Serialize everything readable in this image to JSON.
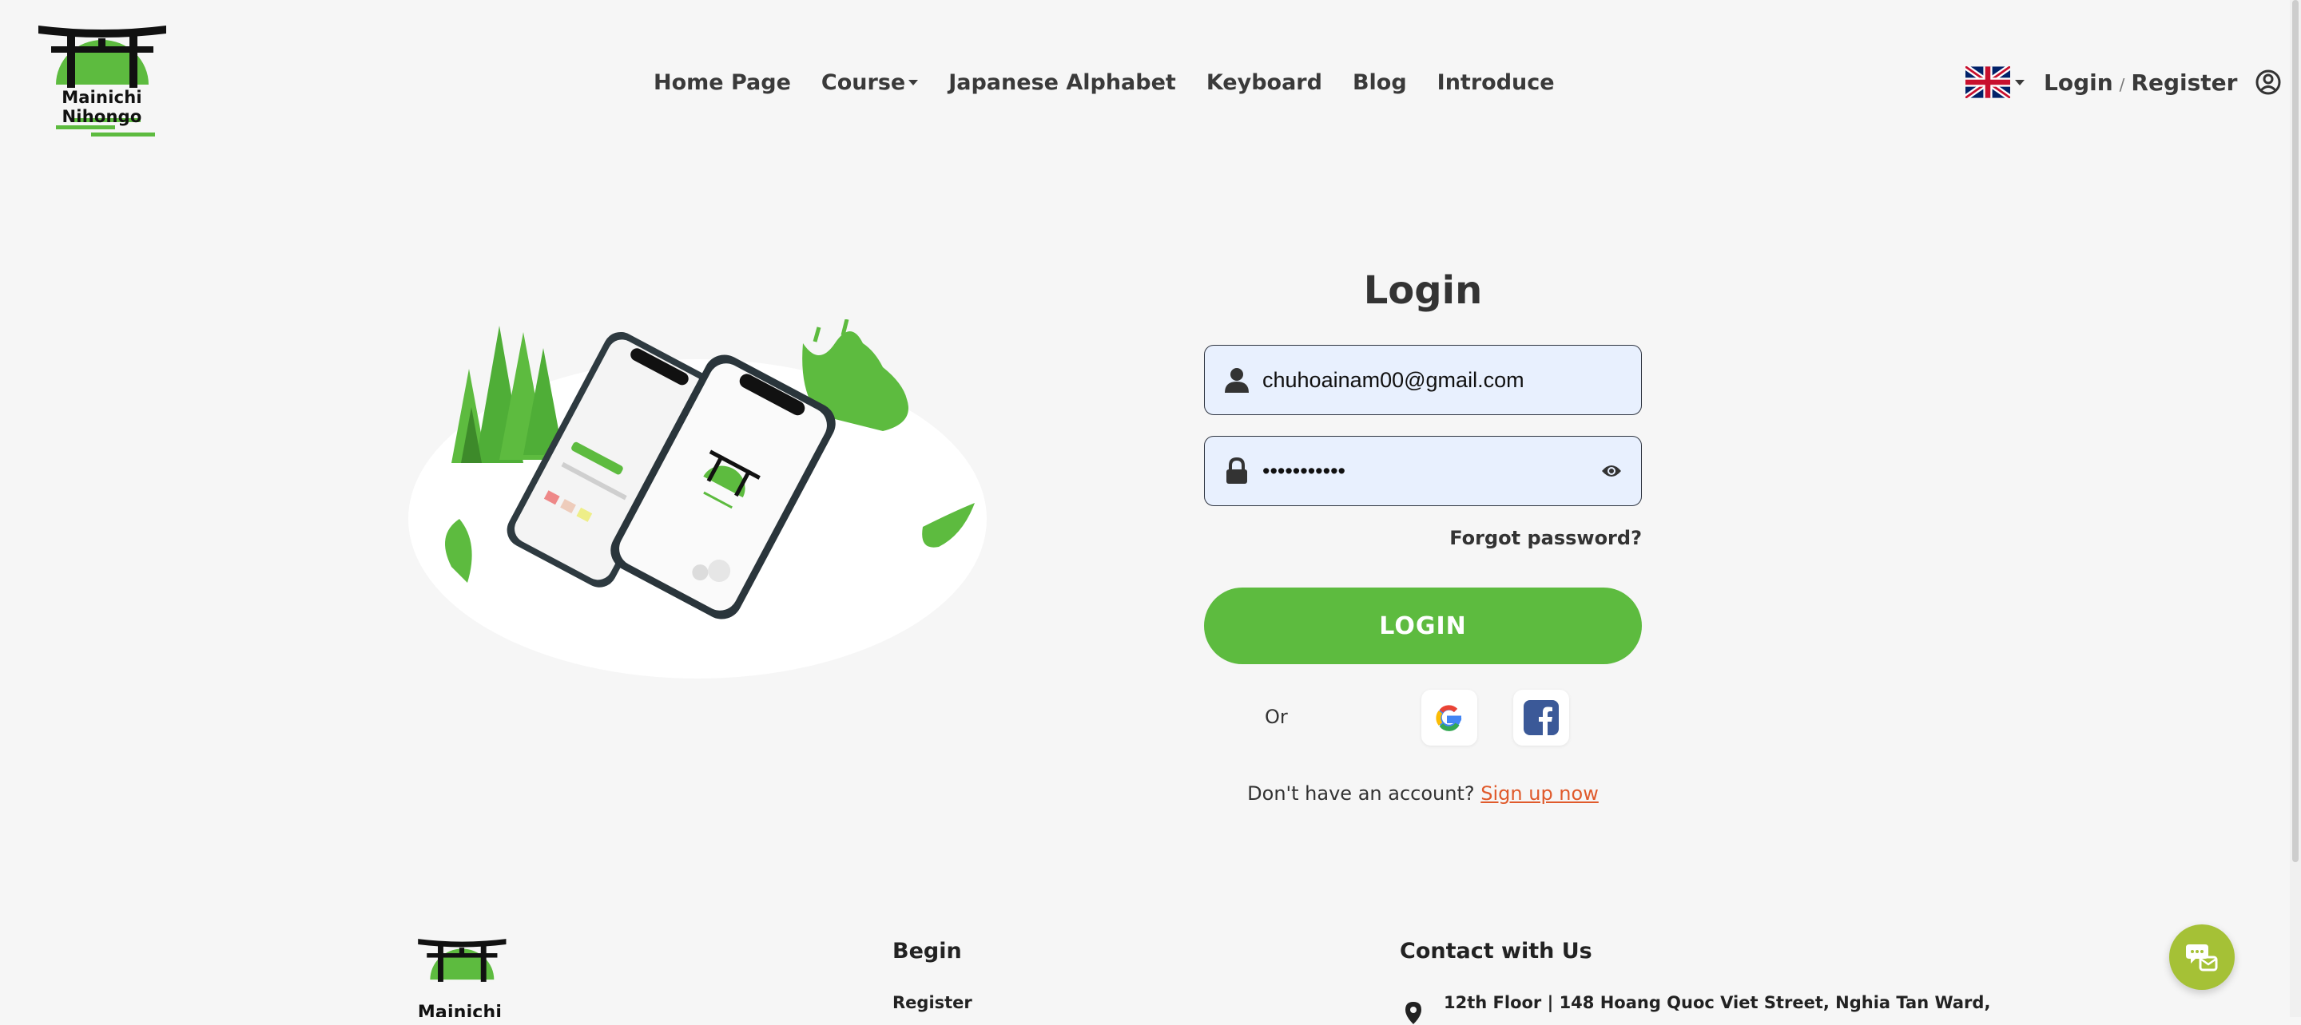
{
  "brand": {
    "name": "Mainichi Nihongo"
  },
  "nav": {
    "home": "Home Page",
    "course": "Course",
    "alphabet": "Japanese Alphabet",
    "keyboard": "Keyboard",
    "blog": "Blog",
    "introduce": "Introduce"
  },
  "header": {
    "login": "Login",
    "separator": "/",
    "register": "Register",
    "language_icon": "uk-flag-icon",
    "user_icon": "user-circle-icon"
  },
  "login": {
    "title": "Login",
    "email_value": "chuhoainam00@gmail.com",
    "password_mask": "•••••••••••",
    "forgot": "Forgot password?",
    "button": "LOGIN",
    "or": "Or",
    "no_account": "Don't have an account?",
    "signup": "Sign up now"
  },
  "footer": {
    "begin_heading": "Begin",
    "begin_links": [
      "Register"
    ],
    "contact_heading": "Contact with Us",
    "address": "12th Floor | 148 Hoang Quoc Viet Street, Nghia Tan Ward,"
  },
  "colors": {
    "accent": "#5dbb3f",
    "link": "#e05a2b",
    "input_bg": "#e8f0fe",
    "chat": "#a5c136"
  }
}
